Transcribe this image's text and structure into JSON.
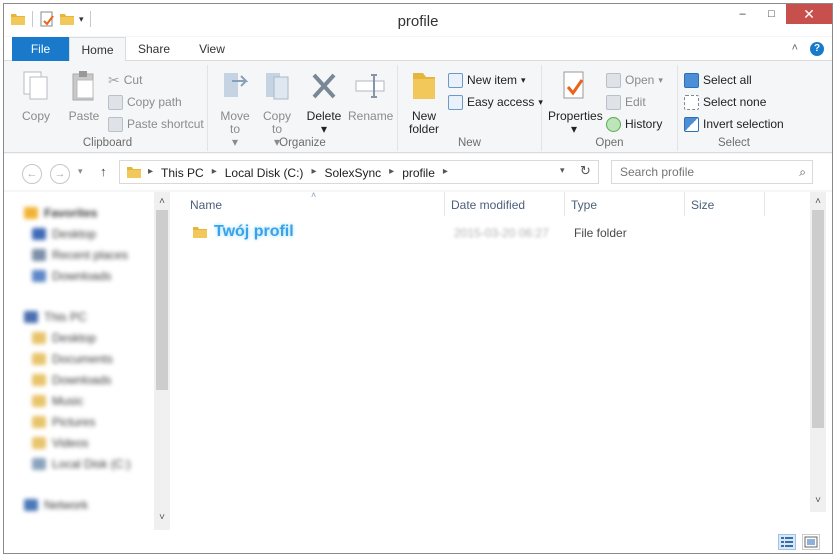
{
  "window": {
    "title": "profile"
  },
  "title_buttons": {
    "minimize": "–",
    "maximize": "□",
    "close": "✕"
  },
  "tabs": {
    "file": "File",
    "home": "Home",
    "share": "Share",
    "view": "View"
  },
  "ribbon": {
    "clipboard": {
      "label": "Clipboard",
      "copy": "Copy",
      "paste": "Paste",
      "cut": "Cut",
      "copy_path": "Copy path",
      "paste_shortcut": "Paste shortcut"
    },
    "organize": {
      "label": "Organize",
      "move_to": "Move to",
      "copy_to": "Copy to",
      "delete": "Delete",
      "rename": "Rename"
    },
    "new": {
      "label": "New",
      "new_folder": "New folder",
      "new_item": "New item",
      "easy_access": "Easy access"
    },
    "open": {
      "label": "Open",
      "properties": "Properties",
      "open": "Open",
      "edit": "Edit",
      "history": "History"
    },
    "select": {
      "label": "Select",
      "select_all": "Select all",
      "select_none": "Select none",
      "invert_selection": "Invert selection"
    }
  },
  "address": {
    "crumbs": [
      "This PC",
      "Local Disk (C:)",
      "SolexSync",
      "profile"
    ],
    "search_placeholder": "Search profile"
  },
  "navpane": {
    "items": [
      "Favorites",
      "Desktop",
      "Recent places",
      "Downloads",
      "This PC",
      "Desktop",
      "Documents",
      "Downloads",
      "Music",
      "Pictures",
      "Videos",
      "Local Disk (C:)",
      "Network"
    ]
  },
  "columns": {
    "name": "Name",
    "date": "Date modified",
    "type": "Type",
    "size": "Size"
  },
  "files": [
    {
      "name": "Twój profil",
      "date": "2015-03-20 06:27",
      "type": "File folder"
    }
  ],
  "colors": {
    "accent": "#1979ca",
    "folder": "#e8b53c",
    "highlight_text": "#3aa3e8"
  }
}
